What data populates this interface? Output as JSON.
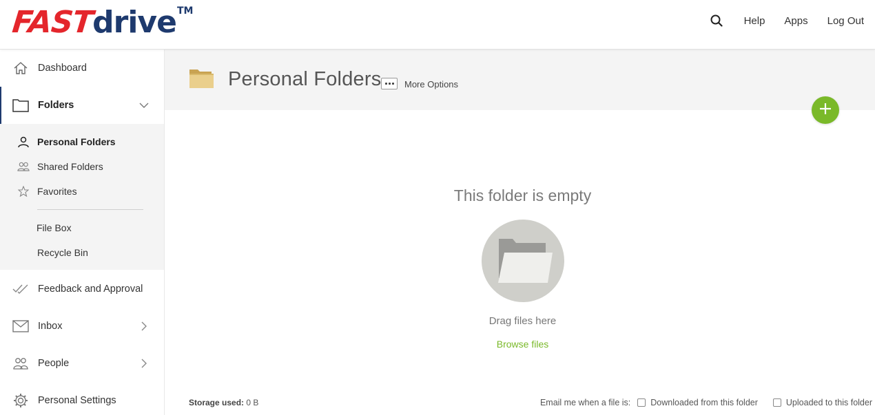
{
  "brand": {
    "logo_part1": "FAST",
    "logo_part2": "drive",
    "logo_tm": "TM",
    "colors": {
      "red": "#e4262c",
      "navy": "#1e3a6e",
      "accent_green": "#7ab929"
    }
  },
  "topnav": {
    "search_icon": "search-icon",
    "help": "Help",
    "apps": "Apps",
    "logout": "Log Out"
  },
  "sidebar": {
    "dashboard": "Dashboard",
    "folders": "Folders",
    "folders_sub": {
      "personal": "Personal Folders",
      "shared": "Shared Folders",
      "favorites": "Favorites",
      "filebox": "File Box",
      "recycle": "Recycle Bin"
    },
    "feedback": "Feedback and Approval",
    "inbox": "Inbox",
    "people": "People",
    "settings": "Personal Settings"
  },
  "main": {
    "title": "Personal Folders",
    "more_options": "More Options",
    "empty_title": "This folder is empty",
    "drag_text": "Drag files here",
    "browse": "Browse files",
    "storage_label": "Storage used:",
    "storage_value": "0 B",
    "notify_label": "Email me when a file is:",
    "notify_downloaded": "Downloaded from this folder",
    "notify_uploaded": "Uploaded to this folder"
  }
}
